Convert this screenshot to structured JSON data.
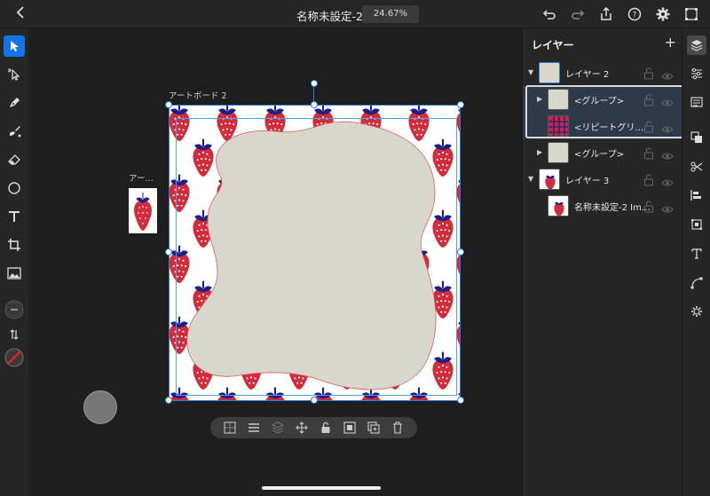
{
  "topbar": {
    "doc_title": "名称未設定-2",
    "zoom": "24.67%",
    "icons": [
      "back-icon",
      "undo-icon",
      "redo-icon",
      "share-icon",
      "help-icon",
      "settings-icon",
      "fullscreen-icon"
    ]
  },
  "left_tools": [
    "select-icon",
    "direct-select-icon",
    "pen-icon",
    "brush-icon",
    "eraser-icon",
    "shape-icon",
    "text-icon",
    "crop-icon",
    "image-icon",
    "stroke-width-icon",
    "swap-icon",
    "fill-none-icon"
  ],
  "canvas": {
    "artboard_main_label": "アートボード 2",
    "artboard_small_label": "アー…"
  },
  "context_bar": [
    "pattern-icon",
    "align-icon",
    "arrange-icon",
    "move-icon",
    "lock-icon",
    "mask-icon",
    "duplicate-icon",
    "delete-icon"
  ],
  "layers": {
    "title": "レイヤー",
    "add": "+",
    "rows": [
      {
        "label": "レイヤー 2"
      },
      {
        "label": "<グループ>"
      },
      {
        "label": "<リピートグリ…"
      },
      {
        "label": "<グループ>"
      },
      {
        "label": "レイヤー 3"
      },
      {
        "label": "名称未設定-2 Im…"
      }
    ]
  },
  "right_tools": [
    "layers-icon",
    "properties-icon",
    "libraries-icon",
    "arrange-panel-icon",
    "scissors-icon",
    "align-panel-icon",
    "transform-icon",
    "type-icon",
    "path-icon",
    "plugins-icon"
  ],
  "colors": {
    "accent": "#1473e6",
    "strawberry_red": "#d22b3a",
    "strawberry_leaf": "#1a1f8a",
    "blob_fill": "#d8d7cc"
  }
}
